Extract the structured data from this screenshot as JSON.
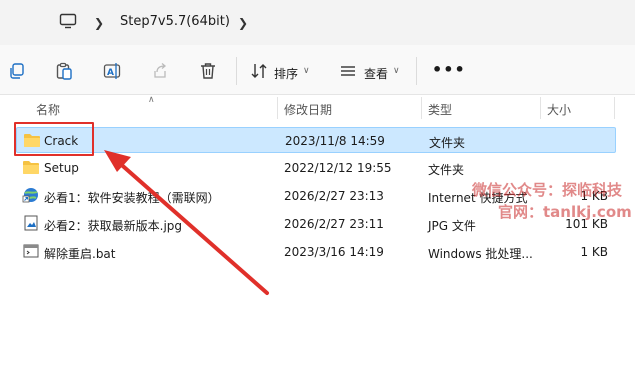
{
  "address": {
    "crumb": "Step7v5.7(64bit)"
  },
  "toolbar": {
    "sort_label": "排序",
    "view_label": "查看"
  },
  "columns": {
    "name": "名称",
    "modified": "修改日期",
    "type": "类型",
    "size": "大小"
  },
  "files": [
    {
      "name": "Crack",
      "modified": "2023/11/8 14:59",
      "type": "文件夹",
      "size": "",
      "icon": "folder-icon",
      "selected": true
    },
    {
      "name": "Setup",
      "modified": "2022/12/12 19:55",
      "type": "文件夹",
      "size": "",
      "icon": "folder-icon",
      "selected": false
    },
    {
      "name": "必看1：软件安装教程（需联网）",
      "modified": "2026/2/27 23:13",
      "type": "Internet 快捷方式",
      "size": "1 KB",
      "icon": "internet-shortcut-icon",
      "selected": false
    },
    {
      "name": "必看2：获取最新版本.jpg",
      "modified": "2026/2/27 23:11",
      "type": "JPG 文件",
      "size": "101 KB",
      "icon": "image-file-icon",
      "selected": false
    },
    {
      "name": "解除重启.bat",
      "modified": "2023/3/16 14:19",
      "type": "Windows 批处理...",
      "size": "1 KB",
      "icon": "batch-file-icon",
      "selected": false
    }
  ],
  "watermark": {
    "line1": "微信公众号：探临科技",
    "line2": "官网：tanlkj.com"
  },
  "colors": {
    "selection": "#cce8ff",
    "selection_border": "#99d1ff",
    "annotation": "#e0302a",
    "folder": "#f5c242"
  }
}
